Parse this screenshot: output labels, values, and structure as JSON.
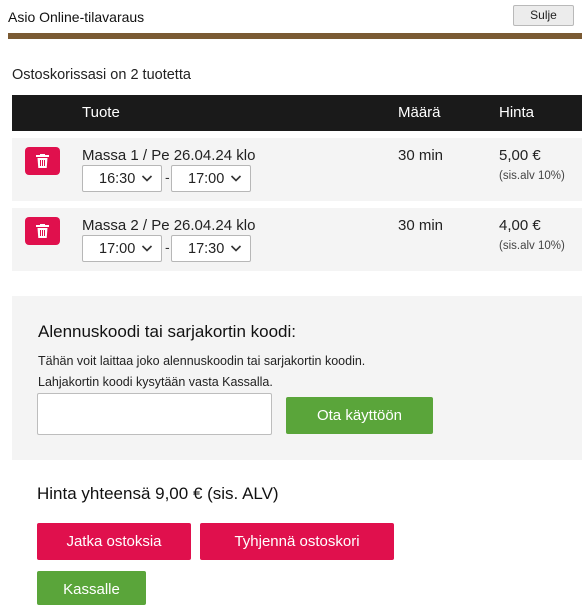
{
  "app_title": "Asio Online-tilavaraus",
  "close_label": "Sulje",
  "cart_count": "Ostoskorissasi on 2 tuotetta",
  "table": {
    "headers": {
      "product": "Tuote",
      "quantity": "Määrä",
      "price": "Hinta"
    },
    "rows": [
      {
        "name": "Massa 1 / Pe 26.04.24 klo",
        "start": "16:30",
        "end": "17:00",
        "quantity": "30 min",
        "price": "5,00 €",
        "vat": "(sis.alv 10%)"
      },
      {
        "name": "Massa 2 / Pe 26.04.24 klo",
        "start": "17:00",
        "end": "17:30",
        "quantity": "30 min",
        "price": "4,00 €",
        "vat": "(sis.alv 10%)"
      }
    ]
  },
  "time_separator": "-",
  "discount": {
    "title": "Alennuskoodi tai sarjakortin koodi:",
    "text1": "Tähän voit laittaa joko alennuskoodin tai sarjakortin koodin.",
    "text2": "Lahjakortin koodi kysytään vasta Kassalla.",
    "input_value": "",
    "apply_label": "Ota käyttöön"
  },
  "total": "Hinta yhteensä 9,00 € (sis. ALV)",
  "buttons": {
    "continue": "Jatka ostoksia",
    "clear": "Tyhjennä ostoskori",
    "checkout": "Kassalle"
  },
  "colors": {
    "brand_brown": "#7a5a33",
    "danger": "#e0104d",
    "success": "#5aa53a",
    "header_bg": "#1a1a1a"
  },
  "icons": {
    "delete": "trash-icon",
    "select": "chevron-down-icon"
  }
}
